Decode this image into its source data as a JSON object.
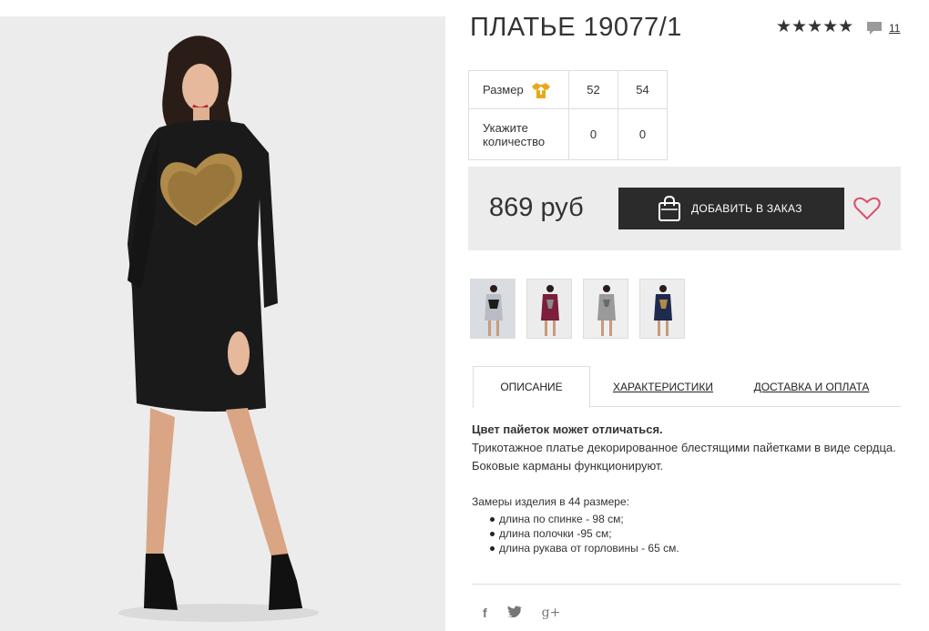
{
  "product": {
    "title": "ПЛАТЬЕ 19077/1",
    "rating_stars": "★★★★★",
    "review_count": "11"
  },
  "sizes": {
    "size_label": "Размер",
    "quantity_label_1": "Укажите",
    "quantity_label_2": "количество",
    "options": [
      {
        "size": "52",
        "qty": "0"
      },
      {
        "size": "54",
        "qty": "0"
      }
    ]
  },
  "buy": {
    "price": "869 руб",
    "add_label": "ДОБАВИТЬ В ЗАКАЗ"
  },
  "thumbnails": [
    {
      "name": "thumb-grey-black",
      "dress_color": "#1c1c1c",
      "bg": "#d9dce1"
    },
    {
      "name": "thumb-burgundy",
      "dress_color": "#7c1e3c",
      "bg": "#ececec"
    },
    {
      "name": "thumb-grey",
      "dress_color": "#9a9a9a",
      "bg": "#efefef"
    },
    {
      "name": "thumb-navy",
      "dress_color": "#1e2b4f",
      "bg": "#ededed"
    }
  ],
  "tabs": {
    "description": "ОПИСАНИЕ",
    "characteristics": "ХАРАКТЕРИСТИКИ",
    "delivery": "ДОСТАВКА И ОПЛАТА"
  },
  "description": {
    "bold_line": "Цвет пайеток может отличаться.",
    "text": "Трикотажное платье декорированное блестящими пайетками в виде сердца. Боковые карманы функционируют.",
    "measures_title": "Замеры изделия в 44 размере:",
    "measures": [
      "длина по спинке - 98 см;",
      "длина полочки -95 см;",
      "длина рукава от горловины - 65 см."
    ]
  },
  "social": {
    "facebook": "f",
    "twitter": "t",
    "googleplus": "g+"
  },
  "colors": {
    "accent_gold": "#e8a81a",
    "heart_pink": "#d9506a",
    "button_dark": "#2b2b2b",
    "panel_grey": "#ececec"
  }
}
